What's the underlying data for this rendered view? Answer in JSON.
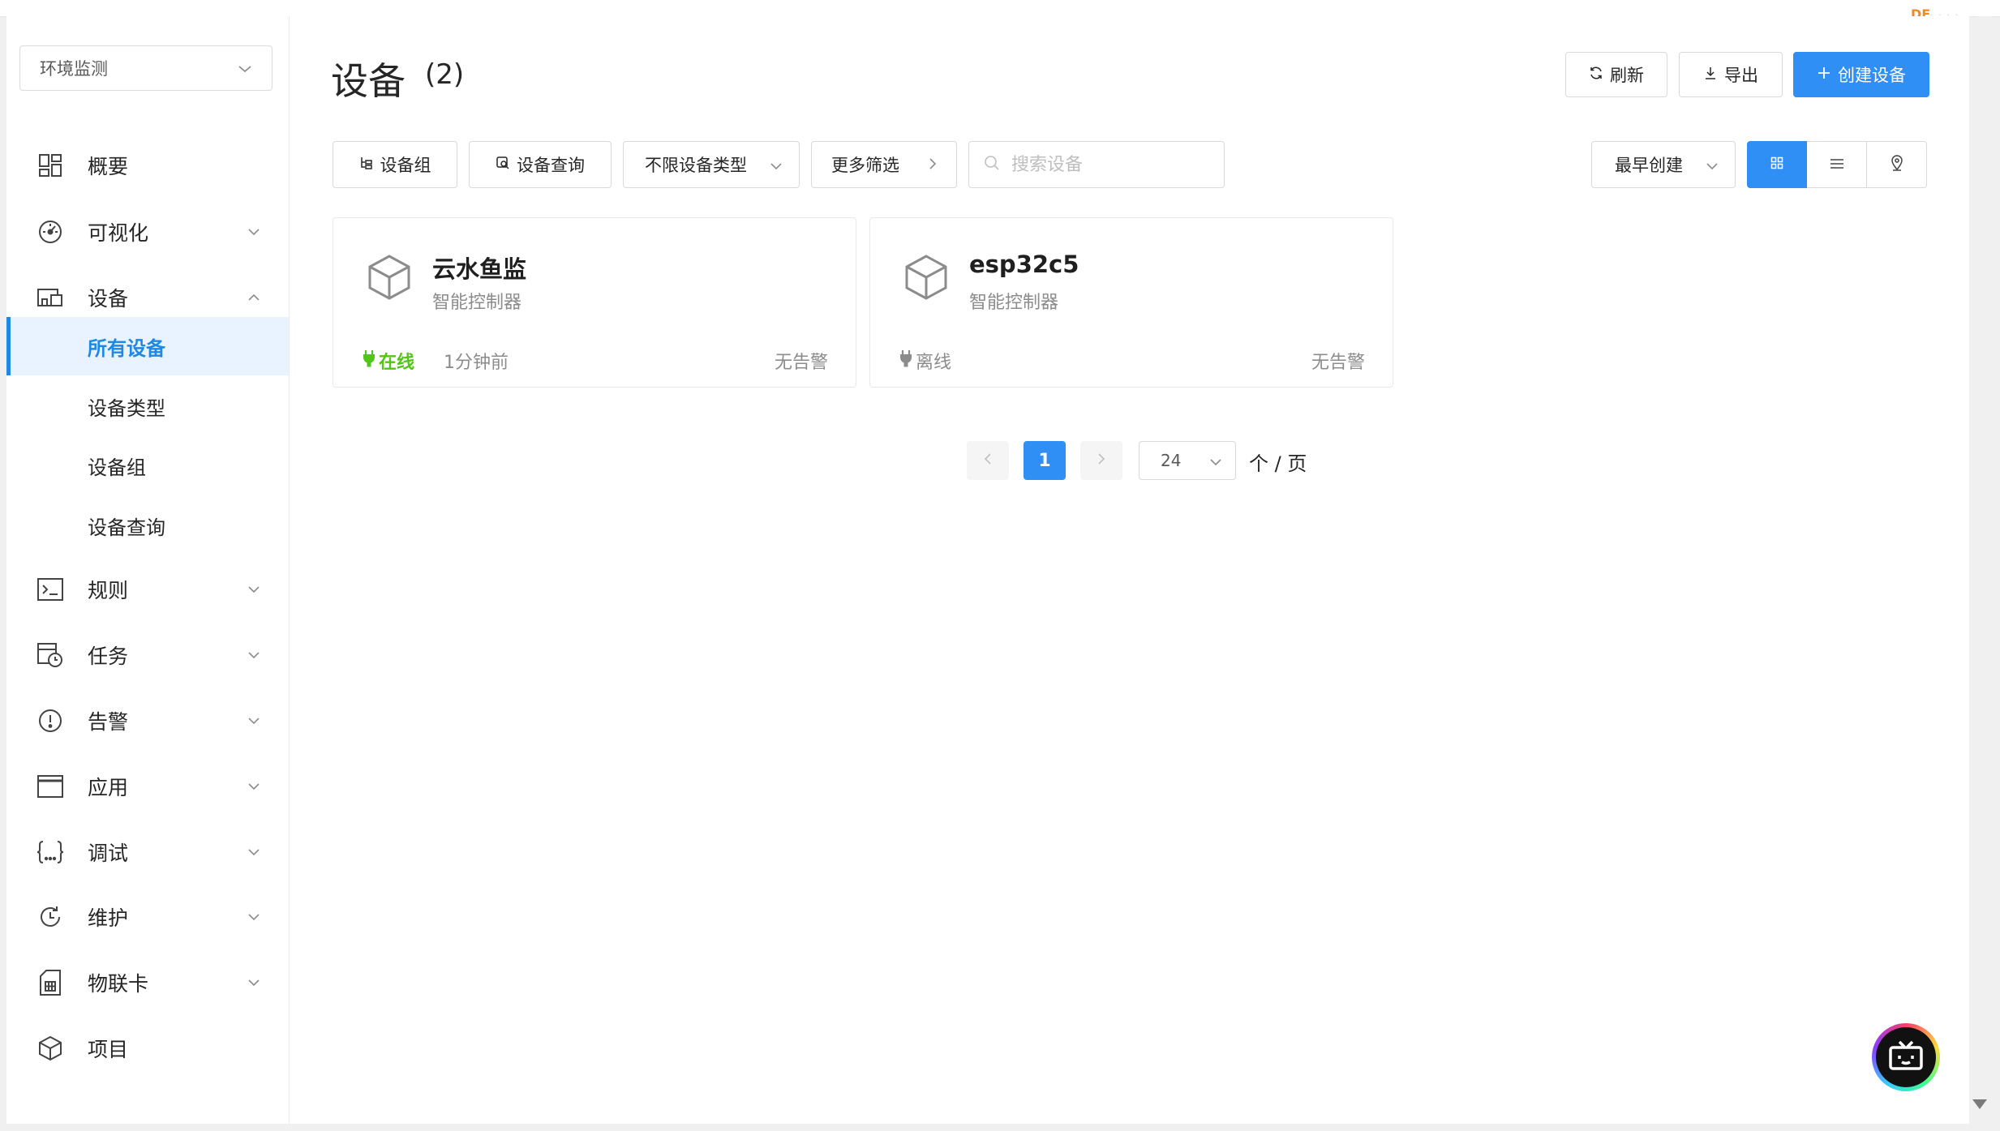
{
  "brand": {
    "mark": "DF",
    "dots": "· · · ·"
  },
  "sidebar": {
    "project_select": "环境监测",
    "items": [
      {
        "label": "概要",
        "icon": "dashboard-icon"
      },
      {
        "label": "可视化",
        "icon": "gauge-icon"
      },
      {
        "label": "设备",
        "icon": "devices-icon"
      },
      {
        "label": "规则",
        "icon": "terminal-icon"
      },
      {
        "label": "任务",
        "icon": "task-clock-icon"
      },
      {
        "label": "告警",
        "icon": "alert-icon"
      },
      {
        "label": "应用",
        "icon": "window-icon"
      },
      {
        "label": "调试",
        "icon": "braces-icon"
      },
      {
        "label": "维护",
        "icon": "refresh-clock-icon"
      },
      {
        "label": "物联卡",
        "icon": "sim-card-icon"
      },
      {
        "label": "项目",
        "icon": "cube-icon"
      }
    ],
    "device_sub": [
      {
        "label": "所有设备",
        "active": true
      },
      {
        "label": "设备类型"
      },
      {
        "label": "设备组"
      },
      {
        "label": "设备查询"
      }
    ]
  },
  "header": {
    "title": "设备",
    "count": "(2)",
    "refresh_label": "刷新",
    "export_label": "导出",
    "create_label": "创建设备"
  },
  "filters": {
    "group_label": "设备组",
    "query_label": "设备查询",
    "type_select": "不限设备类型",
    "more_label": "更多筛选",
    "search_placeholder": "搜索设备",
    "sort_select": "最早创建",
    "view_mode": "grid"
  },
  "devices": [
    {
      "name": "云水鱼监",
      "type": "智能控制器",
      "status": "在线",
      "status_color": "#52c41a",
      "last_seen": "1分钟前",
      "alarm": "无告警"
    },
    {
      "name": "esp32c5",
      "type": "智能控制器",
      "status": "离线",
      "status_color": "#8c8c8c",
      "last_seen": "",
      "alarm": "无告警"
    }
  ],
  "pagination": {
    "current": "1",
    "page_size": "24",
    "suffix": "个 / 页"
  },
  "colors": {
    "primary": "#2f8ff5",
    "online": "#52c41a",
    "offline": "#8c8c8c",
    "active_bg": "#e8f3ff"
  }
}
